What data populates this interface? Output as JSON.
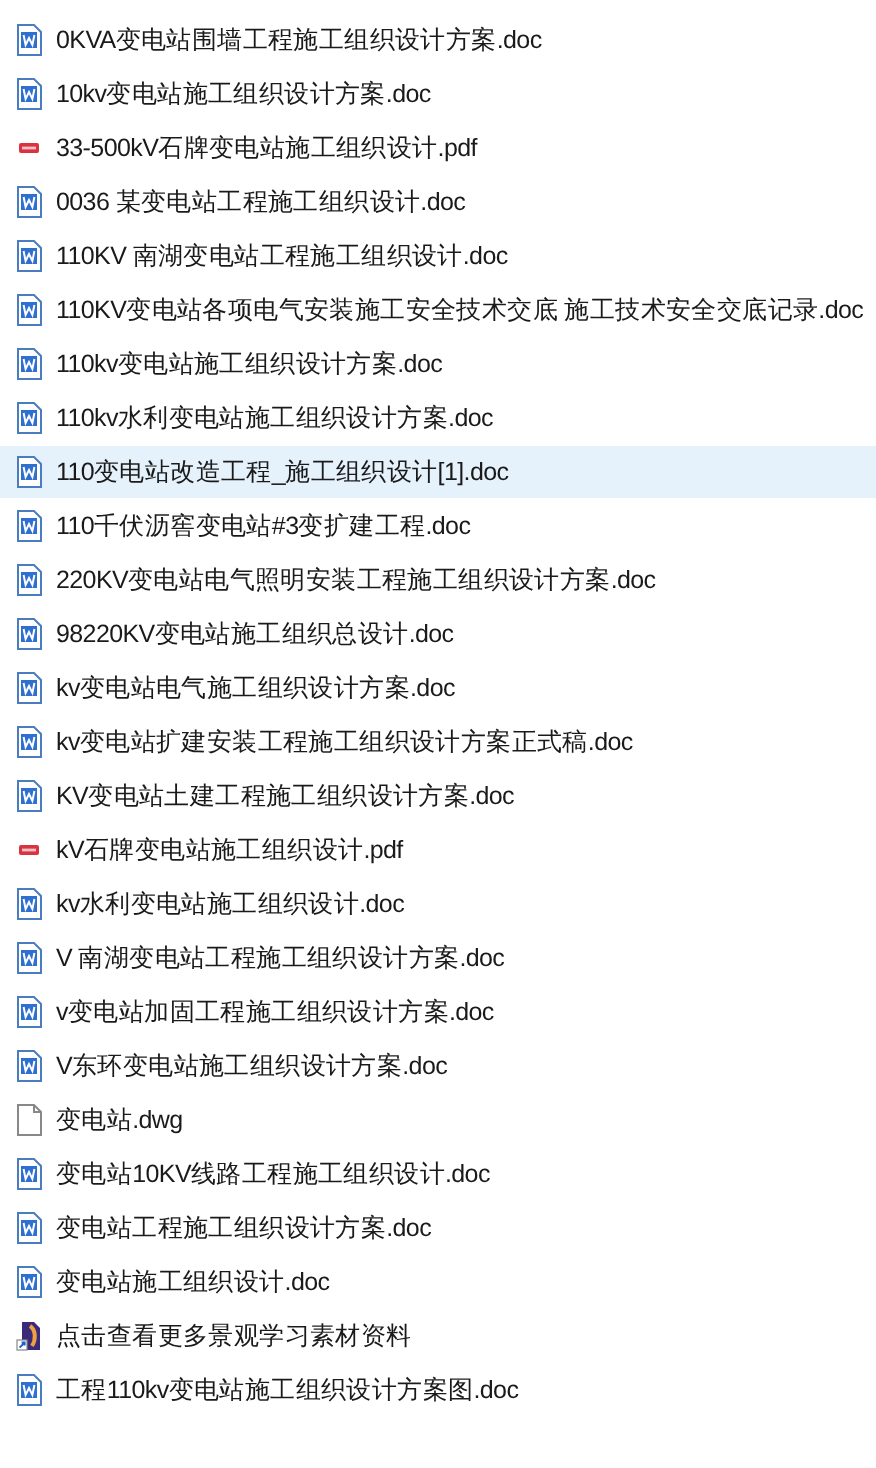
{
  "files": [
    {
      "name": "0KVA变电站围墙工程施工组织设计方案.doc",
      "kind": "doc",
      "selected": false
    },
    {
      "name": "10kv变电站施工组织设计方案.doc",
      "kind": "doc",
      "selected": false
    },
    {
      "name": "33-500kV石牌变电站施工组织设计.pdf",
      "kind": "pdf",
      "selected": false
    },
    {
      "name": "0036 某变电站工程施工组织设计.doc",
      "kind": "doc",
      "selected": false
    },
    {
      "name": "110KV 南湖变电站工程施工组织设计.doc",
      "kind": "doc",
      "selected": false
    },
    {
      "name": "110KV变电站各项电气安装施工安全技术交底 施工技术安全交底记录.doc",
      "kind": "doc",
      "selected": false
    },
    {
      "name": "110kv变电站施工组织设计方案.doc",
      "kind": "doc",
      "selected": false
    },
    {
      "name": "110kv水利变电站施工组织设计方案.doc",
      "kind": "doc",
      "selected": false
    },
    {
      "name": "110变电站改造工程_施工组织设计[1].doc",
      "kind": "doc",
      "selected": true
    },
    {
      "name": "110千伏沥窖变电站#3变扩建工程.doc",
      "kind": "doc",
      "selected": false
    },
    {
      "name": "220KV变电站电气照明安装工程施工组织设计方案.doc",
      "kind": "doc",
      "selected": false
    },
    {
      "name": "98220KV变电站施工组织总设计.doc",
      "kind": "doc",
      "selected": false
    },
    {
      "name": "kv变电站电气施工组织设计方案.doc",
      "kind": "doc",
      "selected": false
    },
    {
      "name": "kv变电站扩建安装工程施工组织设计方案正式稿.doc",
      "kind": "doc",
      "selected": false
    },
    {
      "name": "KV变电站土建工程施工组织设计方案.doc",
      "kind": "doc",
      "selected": false
    },
    {
      "name": "kV石牌变电站施工组织设计.pdf",
      "kind": "pdf",
      "selected": false
    },
    {
      "name": "kv水利变电站施工组织设计.doc",
      "kind": "doc",
      "selected": false
    },
    {
      "name": "V 南湖变电站工程施工组织设计方案.doc",
      "kind": "doc",
      "selected": false
    },
    {
      "name": "v变电站加固工程施工组织设计方案.doc",
      "kind": "doc",
      "selected": false
    },
    {
      "name": "V东环变电站施工组织设计方案.doc",
      "kind": "doc",
      "selected": false
    },
    {
      "name": "变电站.dwg",
      "kind": "blank",
      "selected": false
    },
    {
      "name": "变电站10KV线路工程施工组织设计.doc",
      "kind": "doc",
      "selected": false
    },
    {
      "name": "变电站工程施工组织设计方案.doc",
      "kind": "doc",
      "selected": false
    },
    {
      "name": "变电站施工组织设计.doc",
      "kind": "doc",
      "selected": false
    },
    {
      "name": "点击查看更多景观学习素材资料",
      "kind": "shortcut",
      "selected": false
    },
    {
      "name": "工程110kv变电站施工组织设计方案图.doc",
      "kind": "doc",
      "selected": false
    }
  ]
}
